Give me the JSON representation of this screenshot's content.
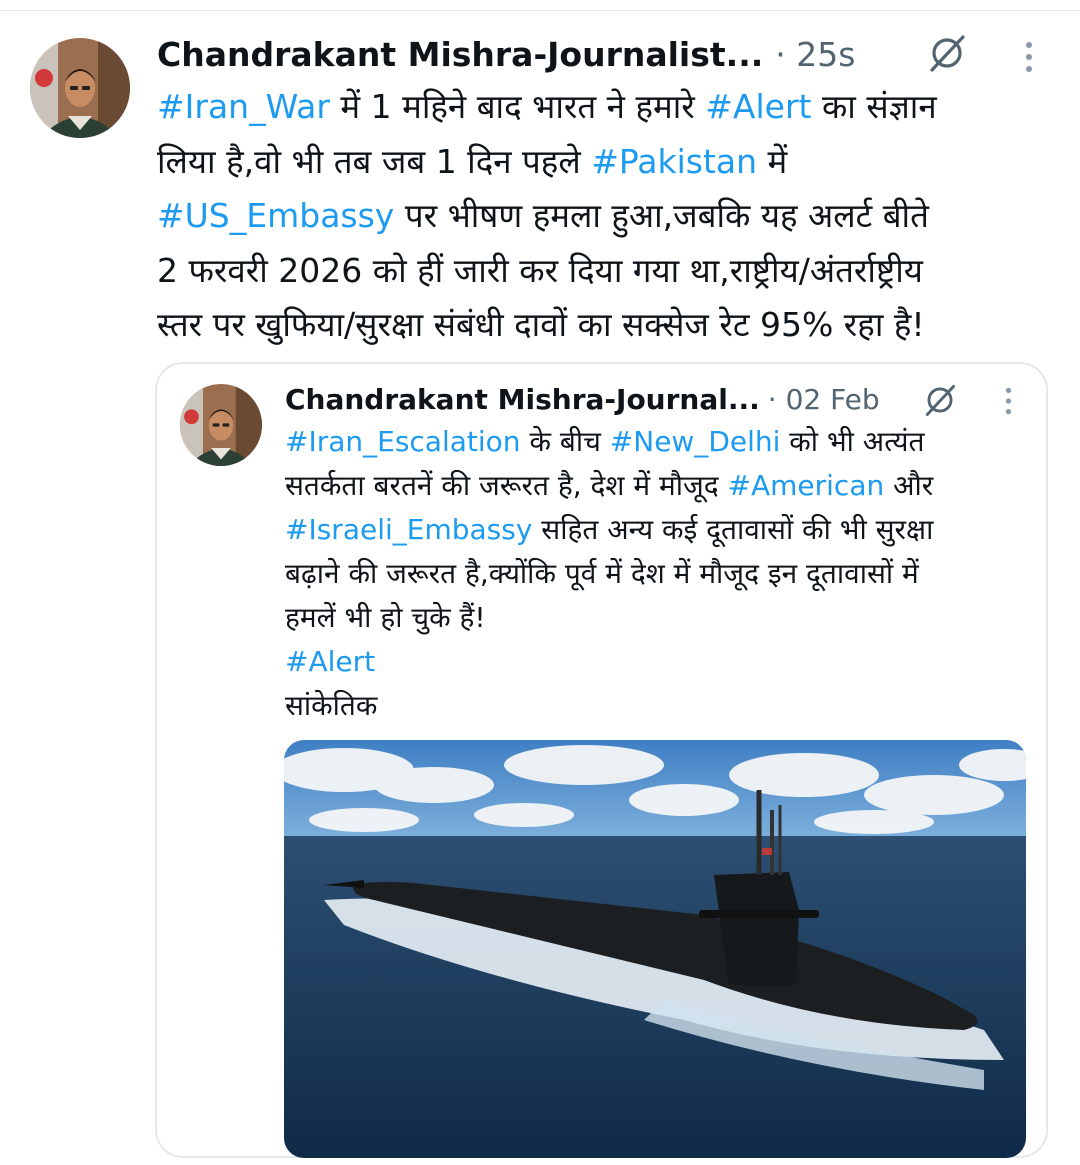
{
  "post": {
    "author_name": "Chandrakant Mishra-Journalist...",
    "meta": "· 25s",
    "lines": [
      [
        {
          "t": "#Iran_War",
          "h": true
        },
        {
          "t": " में 1 महिने बाद भारत ने हमारे "
        },
        {
          "t": "#Alert",
          "h": true
        },
        {
          "t": " का संज्ञान"
        }
      ],
      [
        {
          "t": "लिया है,वो भी तब जब 1 दिन पहले "
        },
        {
          "t": "#Pakistan",
          "h": true
        },
        {
          "t": " में"
        }
      ],
      [
        {
          "t": "#US_Embassy",
          "h": true
        },
        {
          "t": " पर भीषण हमला हुआ,जबकि यह अलर्ट बीते"
        }
      ],
      [
        {
          "t": "2 फरवरी 2026 को हीं जारी कर दिया गया था,राष्ट्रीय/अंतर्राष्ट्रीय"
        }
      ],
      [
        {
          "t": "स्तर पर खुफिया/सुरक्षा संबंधी दावों का सक्सेज रेट 95% रहा है!"
        }
      ]
    ]
  },
  "quoted_post": {
    "author_name": "Chandrakant Mishra-Journal...",
    "meta": "· 02 Feb",
    "lines": [
      [
        {
          "t": "#Iran_Escalation",
          "h": true
        },
        {
          "t": " के बीच "
        },
        {
          "t": "#New_Delhi",
          "h": true
        },
        {
          "t": " को भी अत्यंत"
        }
      ],
      [
        {
          "t": "सतर्कता बरतनें की जरूरत है, देश में मौजूद "
        },
        {
          "t": "#American",
          "h": true
        },
        {
          "t": " और"
        }
      ],
      [
        {
          "t": "#Israeli_Embassy",
          "h": true
        },
        {
          "t": " सहित अन्य कई दूतावासों की भी सुरक्षा"
        }
      ],
      [
        {
          "t": "बढ़ाने की जरूरत है,क्योंकि पूर्व में देश में मौजूद इन दूतावासों में"
        }
      ],
      [
        {
          "t": "हमलें भी हो चुके हैं!"
        }
      ],
      [
        {
          "t": "#Alert",
          "h": true
        }
      ],
      [
        {
          "t": "सांकेतिक"
        }
      ]
    ],
    "media_description_icon": "submarine-photo"
  },
  "colors": {
    "hashtag": "#1d9bf0",
    "text": "#0f1419",
    "meta": "#536471",
    "border": "#e3e7ea"
  }
}
